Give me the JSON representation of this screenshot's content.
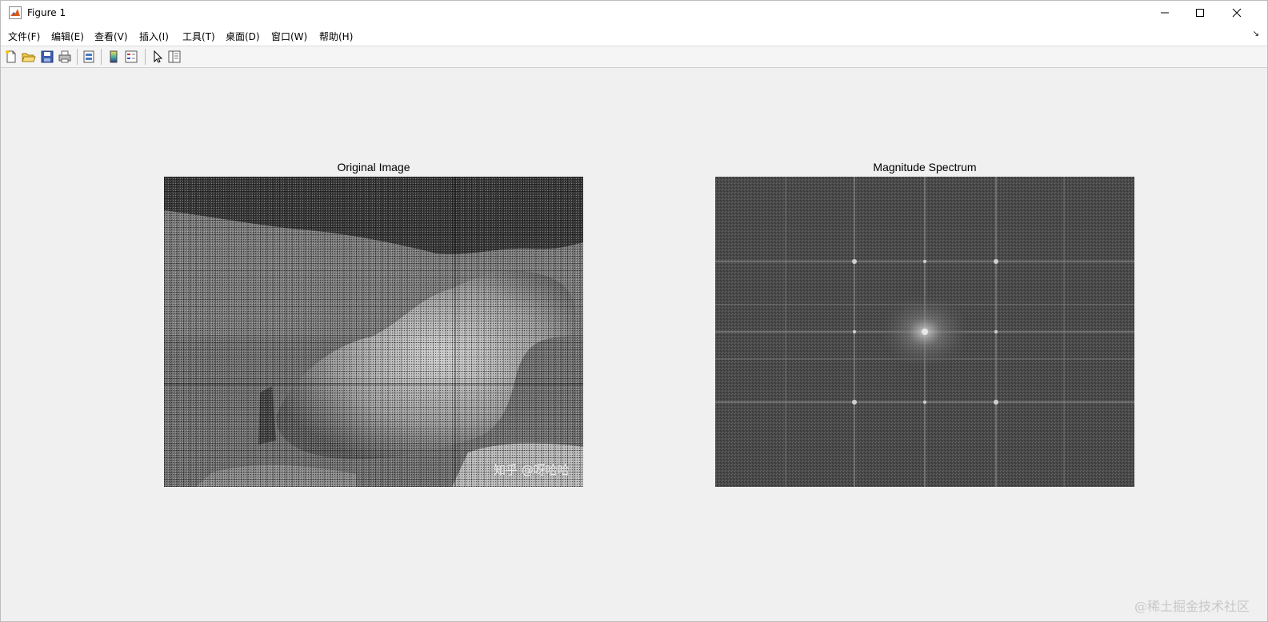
{
  "window": {
    "title": "Figure 1"
  },
  "menu": {
    "items": [
      {
        "label": "文件(F)"
      },
      {
        "label": "编辑(E)"
      },
      {
        "label": "查看(V)"
      },
      {
        "label": "插入(I)"
      },
      {
        "label": "工具(T)"
      },
      {
        "label": "桌面(D)"
      },
      {
        "label": "窗口(W)"
      },
      {
        "label": "帮助(H)"
      }
    ],
    "corner_glyph": "↘"
  },
  "toolbar": {
    "icons": [
      "new-figure-icon",
      "open-file-icon",
      "save-icon",
      "print-icon",
      "print-preview-icon",
      "colorbar-icon",
      "legend-icon",
      "pointer-icon",
      "property-inspector-icon"
    ]
  },
  "axes": [
    {
      "title": "Original Image",
      "image_watermark": "知乎 @呀哈哈"
    },
    {
      "title": "Magnitude Spectrum"
    }
  ],
  "page_watermark": "@稀土掘金技术社区"
}
